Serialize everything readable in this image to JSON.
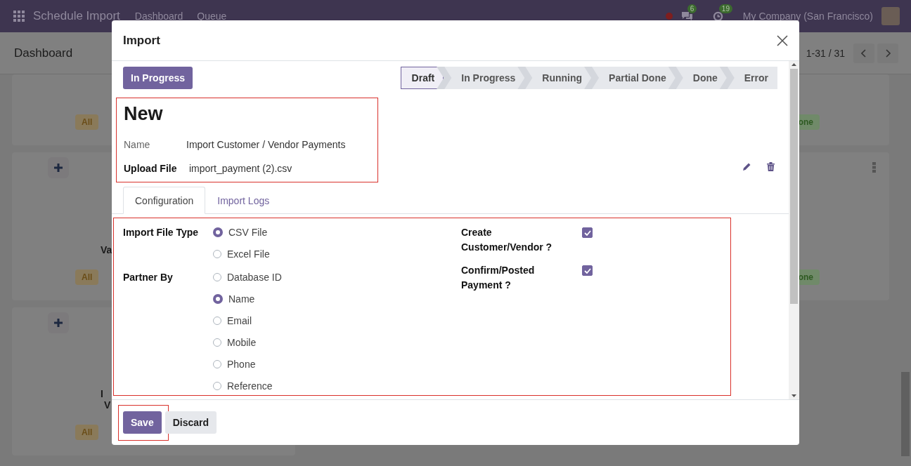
{
  "navbar": {
    "app_title": "Schedule Import",
    "menu": [
      "Dashboard",
      "Queue"
    ],
    "messages_count": "6",
    "activities_count": "19",
    "company": "My Company (San Francisco)"
  },
  "control_panel": {
    "breadcrumb": "Dashboard",
    "pager": "1-31 / 31"
  },
  "left_cards": [
    {
      "add_button": false,
      "badge": "All"
    },
    {
      "add_button": true,
      "title_lines": [
        "Va"
      ],
      "badge": "All"
    },
    {
      "add_button": true,
      "title_lines": [
        "I",
        "V"
      ],
      "badge": "All"
    }
  ],
  "right_cards": [
    {
      "menu": false,
      "badge": "one"
    },
    {
      "menu": true,
      "badge": "one"
    }
  ],
  "dialog": {
    "title": "Import",
    "status_button": "In Progress",
    "stages": [
      {
        "label": "Draft",
        "selected": true
      },
      {
        "label": "In Progress",
        "selected": false
      },
      {
        "label": "Running",
        "selected": false
      },
      {
        "label": "Partial Done",
        "selected": false
      },
      {
        "label": "Done",
        "selected": false
      },
      {
        "label": "Error",
        "selected": false
      }
    ],
    "record_title": "New",
    "fields": [
      {
        "label": "Name",
        "value": "Import Customer / Vendor Payments",
        "kind": "text"
      },
      {
        "label": "Upload File",
        "value": "import_payment (2).csv",
        "kind": "file"
      }
    ],
    "tabs": [
      {
        "label": "Configuration",
        "selected": true
      },
      {
        "label": "Import Logs",
        "selected": false
      }
    ],
    "option_groups": [
      {
        "label": "Import File Type",
        "options": [
          {
            "label": "CSV File",
            "selected": true
          },
          {
            "label": "Excel File",
            "selected": false
          }
        ]
      },
      {
        "label": "Partner By",
        "options": [
          {
            "label": "Database ID",
            "selected": false
          },
          {
            "label": "Name",
            "selected": true
          },
          {
            "label": "Email",
            "selected": false
          },
          {
            "label": "Mobile",
            "selected": false
          },
          {
            "label": "Phone",
            "selected": false
          },
          {
            "label": "Reference",
            "selected": false
          }
        ]
      }
    ],
    "checkboxes": [
      {
        "label": "Create Customer/Vendor ?",
        "checked": true
      },
      {
        "label": "Confirm/Posted Payment ?",
        "checked": true
      }
    ],
    "buttons": [
      {
        "label": "Save",
        "kind": "primary"
      },
      {
        "label": "Discard",
        "kind": "secondary"
      }
    ]
  }
}
